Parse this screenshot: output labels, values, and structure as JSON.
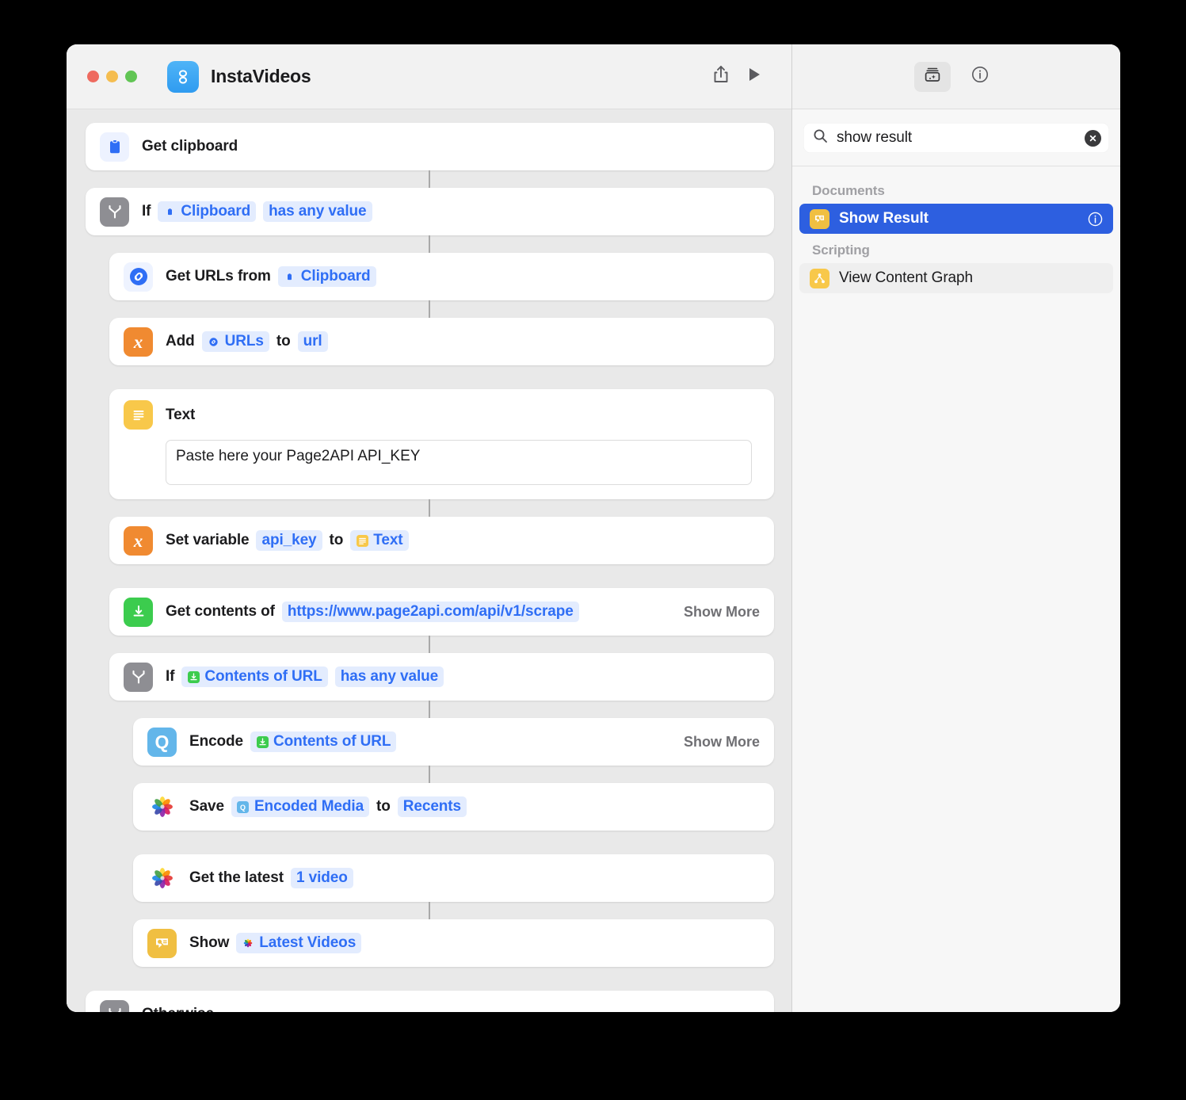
{
  "window": {
    "app_title": "InstaVideos",
    "app_icon": "shortcuts-icon",
    "traffic_lights": [
      "close-button",
      "minimize-button",
      "zoom-button"
    ],
    "toolbar": {
      "share_label": "share-icon",
      "run_label": "run-icon",
      "library_label": "action-library-icon",
      "info_label": "info-icon"
    }
  },
  "search": {
    "value": "show result",
    "placeholder": "Search",
    "icon": "search-icon",
    "clear_icon": "clear-icon"
  },
  "results": {
    "groups": [
      {
        "label": "Documents",
        "items": [
          {
            "label": "Show Result",
            "icon": "quick-look-icon",
            "selected": true,
            "has_info": true
          }
        ]
      },
      {
        "label": "Scripting",
        "items": [
          {
            "label": "View Content Graph",
            "icon": "content-graph-icon",
            "selected": false,
            "has_info": false
          }
        ]
      }
    ]
  },
  "workflow": {
    "actions": [
      {
        "id": "get-clipboard",
        "indent": 0,
        "icon": "clipboard-icon",
        "connector": "none",
        "parts": [
          {
            "type": "text",
            "value": "Get clipboard"
          }
        ]
      },
      {
        "id": "if-clipboard",
        "indent": 0,
        "icon": "if-branch-icon",
        "connector": "line",
        "parts": [
          {
            "type": "text",
            "value": "If"
          },
          {
            "type": "pill",
            "value": "Clipboard",
            "mini": "clipboard-mini"
          },
          {
            "type": "pill",
            "value": "has any value"
          }
        ]
      },
      {
        "id": "get-urls",
        "indent": 1,
        "icon": "link-icon",
        "connector": "line",
        "parts": [
          {
            "type": "text",
            "value": "Get URLs from"
          },
          {
            "type": "pill",
            "value": "Clipboard",
            "mini": "clipboard-mini"
          }
        ]
      },
      {
        "id": "add-urls",
        "indent": 1,
        "icon": "variable-x-icon",
        "connector": "line",
        "parts": [
          {
            "type": "text",
            "value": "Add"
          },
          {
            "type": "pill",
            "value": "URLs",
            "mini": "link-mini"
          },
          {
            "type": "text",
            "value": "to"
          },
          {
            "type": "pill",
            "value": "url"
          }
        ]
      },
      {
        "id": "text-block",
        "indent": 1,
        "icon": "text-icon",
        "connector": "gap",
        "parts": [
          {
            "type": "text",
            "value": "Text"
          }
        ],
        "field_value": "Paste here your Page2API API_KEY"
      },
      {
        "id": "set-variable",
        "indent": 1,
        "icon": "variable-x-icon",
        "connector": "line",
        "parts": [
          {
            "type": "text",
            "value": "Set variable"
          },
          {
            "type": "pill",
            "value": "api_key"
          },
          {
            "type": "text",
            "value": "to"
          },
          {
            "type": "pill",
            "value": "Text",
            "mini": "text-mini"
          }
        ]
      },
      {
        "id": "get-contents",
        "indent": 1,
        "icon": "get-contents-icon",
        "connector": "gap",
        "parts": [
          {
            "type": "text",
            "value": "Get contents of"
          },
          {
            "type": "pill",
            "value": "https://www.page2api.com/api/v1/scrape"
          }
        ],
        "show_more": "Show More"
      },
      {
        "id": "if-contents",
        "indent": 1,
        "icon": "if-branch-icon",
        "connector": "line",
        "parts": [
          {
            "type": "text",
            "value": "If"
          },
          {
            "type": "pill",
            "value": "Contents of URL",
            "mini": "get-contents-mini"
          },
          {
            "type": "pill",
            "value": "has any value"
          }
        ]
      },
      {
        "id": "encode-media",
        "indent": 2,
        "icon": "encode-media-icon",
        "connector": "line",
        "parts": [
          {
            "type": "text",
            "value": "Encode"
          },
          {
            "type": "pill",
            "value": "Contents of URL",
            "mini": "get-contents-mini"
          }
        ],
        "show_more": "Show More"
      },
      {
        "id": "save-to-photos",
        "indent": 2,
        "icon": "photos-icon",
        "connector": "line",
        "parts": [
          {
            "type": "text",
            "value": "Save"
          },
          {
            "type": "pill",
            "value": "Encoded Media",
            "mini": "encode-mini"
          },
          {
            "type": "text",
            "value": "to"
          },
          {
            "type": "pill",
            "value": "Recents"
          }
        ]
      },
      {
        "id": "get-latest-videos",
        "indent": 2,
        "icon": "photos-icon",
        "connector": "gap",
        "parts": [
          {
            "type": "text",
            "value": "Get the latest"
          },
          {
            "type": "pill",
            "value": "1 video"
          }
        ]
      },
      {
        "id": "show-latest-videos",
        "indent": 2,
        "icon": "quick-look-icon",
        "connector": "line",
        "parts": [
          {
            "type": "text",
            "value": "Show"
          },
          {
            "type": "pill",
            "value": "Latest Videos",
            "mini": "photos-mini"
          }
        ]
      },
      {
        "id": "otherwise",
        "indent": 0,
        "icon": "if-branch-icon",
        "connector": "gap",
        "parts": [
          {
            "type": "text",
            "value": "Otherwise"
          }
        ]
      }
    ]
  }
}
